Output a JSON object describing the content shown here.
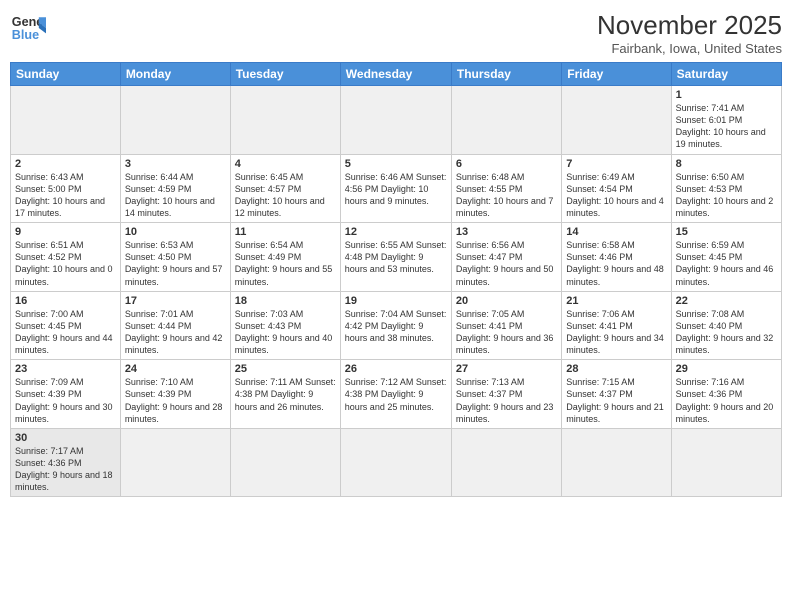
{
  "logo": {
    "line1": "General",
    "line2": "Blue"
  },
  "title": "November 2025",
  "subtitle": "Fairbank, Iowa, United States",
  "days_of_week": [
    "Sunday",
    "Monday",
    "Tuesday",
    "Wednesday",
    "Thursday",
    "Friday",
    "Saturday"
  ],
  "weeks": [
    [
      {
        "day": "",
        "info": ""
      },
      {
        "day": "",
        "info": ""
      },
      {
        "day": "",
        "info": ""
      },
      {
        "day": "",
        "info": ""
      },
      {
        "day": "",
        "info": ""
      },
      {
        "day": "",
        "info": ""
      },
      {
        "day": "1",
        "info": "Sunrise: 7:41 AM\nSunset: 6:01 PM\nDaylight: 10 hours\nand 19 minutes."
      }
    ],
    [
      {
        "day": "2",
        "info": "Sunrise: 6:43 AM\nSunset: 5:00 PM\nDaylight: 10 hours\nand 17 minutes."
      },
      {
        "day": "3",
        "info": "Sunrise: 6:44 AM\nSunset: 4:59 PM\nDaylight: 10 hours\nand 14 minutes."
      },
      {
        "day": "4",
        "info": "Sunrise: 6:45 AM\nSunset: 4:57 PM\nDaylight: 10 hours\nand 12 minutes."
      },
      {
        "day": "5",
        "info": "Sunrise: 6:46 AM\nSunset: 4:56 PM\nDaylight: 10 hours\nand 9 minutes."
      },
      {
        "day": "6",
        "info": "Sunrise: 6:48 AM\nSunset: 4:55 PM\nDaylight: 10 hours\nand 7 minutes."
      },
      {
        "day": "7",
        "info": "Sunrise: 6:49 AM\nSunset: 4:54 PM\nDaylight: 10 hours\nand 4 minutes."
      },
      {
        "day": "8",
        "info": "Sunrise: 6:50 AM\nSunset: 4:53 PM\nDaylight: 10 hours\nand 2 minutes."
      }
    ],
    [
      {
        "day": "9",
        "info": "Sunrise: 6:51 AM\nSunset: 4:52 PM\nDaylight: 10 hours\nand 0 minutes."
      },
      {
        "day": "10",
        "info": "Sunrise: 6:53 AM\nSunset: 4:50 PM\nDaylight: 9 hours\nand 57 minutes."
      },
      {
        "day": "11",
        "info": "Sunrise: 6:54 AM\nSunset: 4:49 PM\nDaylight: 9 hours\nand 55 minutes."
      },
      {
        "day": "12",
        "info": "Sunrise: 6:55 AM\nSunset: 4:48 PM\nDaylight: 9 hours\nand 53 minutes."
      },
      {
        "day": "13",
        "info": "Sunrise: 6:56 AM\nSunset: 4:47 PM\nDaylight: 9 hours\nand 50 minutes."
      },
      {
        "day": "14",
        "info": "Sunrise: 6:58 AM\nSunset: 4:46 PM\nDaylight: 9 hours\nand 48 minutes."
      },
      {
        "day": "15",
        "info": "Sunrise: 6:59 AM\nSunset: 4:45 PM\nDaylight: 9 hours\nand 46 minutes."
      }
    ],
    [
      {
        "day": "16",
        "info": "Sunrise: 7:00 AM\nSunset: 4:45 PM\nDaylight: 9 hours\nand 44 minutes."
      },
      {
        "day": "17",
        "info": "Sunrise: 7:01 AM\nSunset: 4:44 PM\nDaylight: 9 hours\nand 42 minutes."
      },
      {
        "day": "18",
        "info": "Sunrise: 7:03 AM\nSunset: 4:43 PM\nDaylight: 9 hours\nand 40 minutes."
      },
      {
        "day": "19",
        "info": "Sunrise: 7:04 AM\nSunset: 4:42 PM\nDaylight: 9 hours\nand 38 minutes."
      },
      {
        "day": "20",
        "info": "Sunrise: 7:05 AM\nSunset: 4:41 PM\nDaylight: 9 hours\nand 36 minutes."
      },
      {
        "day": "21",
        "info": "Sunrise: 7:06 AM\nSunset: 4:41 PM\nDaylight: 9 hours\nand 34 minutes."
      },
      {
        "day": "22",
        "info": "Sunrise: 7:08 AM\nSunset: 4:40 PM\nDaylight: 9 hours\nand 32 minutes."
      }
    ],
    [
      {
        "day": "23",
        "info": "Sunrise: 7:09 AM\nSunset: 4:39 PM\nDaylight: 9 hours\nand 30 minutes."
      },
      {
        "day": "24",
        "info": "Sunrise: 7:10 AM\nSunset: 4:39 PM\nDaylight: 9 hours\nand 28 minutes."
      },
      {
        "day": "25",
        "info": "Sunrise: 7:11 AM\nSunset: 4:38 PM\nDaylight: 9 hours\nand 26 minutes."
      },
      {
        "day": "26",
        "info": "Sunrise: 7:12 AM\nSunset: 4:38 PM\nDaylight: 9 hours\nand 25 minutes."
      },
      {
        "day": "27",
        "info": "Sunrise: 7:13 AM\nSunset: 4:37 PM\nDaylight: 9 hours\nand 23 minutes."
      },
      {
        "day": "28",
        "info": "Sunrise: 7:15 AM\nSunset: 4:37 PM\nDaylight: 9 hours\nand 21 minutes."
      },
      {
        "day": "29",
        "info": "Sunrise: 7:16 AM\nSunset: 4:36 PM\nDaylight: 9 hours\nand 20 minutes."
      }
    ],
    [
      {
        "day": "30",
        "info": "Sunrise: 7:17 AM\nSunset: 4:36 PM\nDaylight: 9 hours\nand 18 minutes."
      },
      {
        "day": "",
        "info": ""
      },
      {
        "day": "",
        "info": ""
      },
      {
        "day": "",
        "info": ""
      },
      {
        "day": "",
        "info": ""
      },
      {
        "day": "",
        "info": ""
      },
      {
        "day": "",
        "info": ""
      }
    ]
  ]
}
